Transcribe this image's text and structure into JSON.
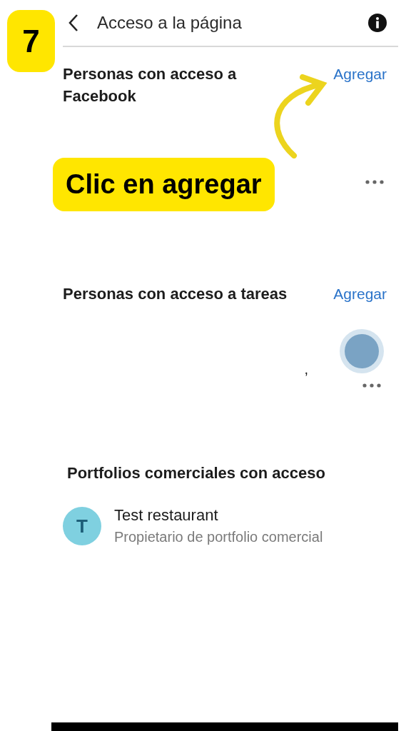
{
  "step_badge": "7",
  "header": {
    "title": "Acceso a la página"
  },
  "sections": [
    {
      "title": "Personas con acceso a Facebook",
      "action": "Agregar"
    },
    {
      "title": "Personas con acceso a tareas",
      "action": "Agregar",
      "fragment": ","
    }
  ],
  "portfolios": {
    "title": "Portfolios comerciales con acceso",
    "items": [
      {
        "initial": "T",
        "name": "Test restaurant",
        "role": "Propietario de portfolio comercial"
      }
    ]
  },
  "callout": {
    "text": "Clic en agregar"
  }
}
